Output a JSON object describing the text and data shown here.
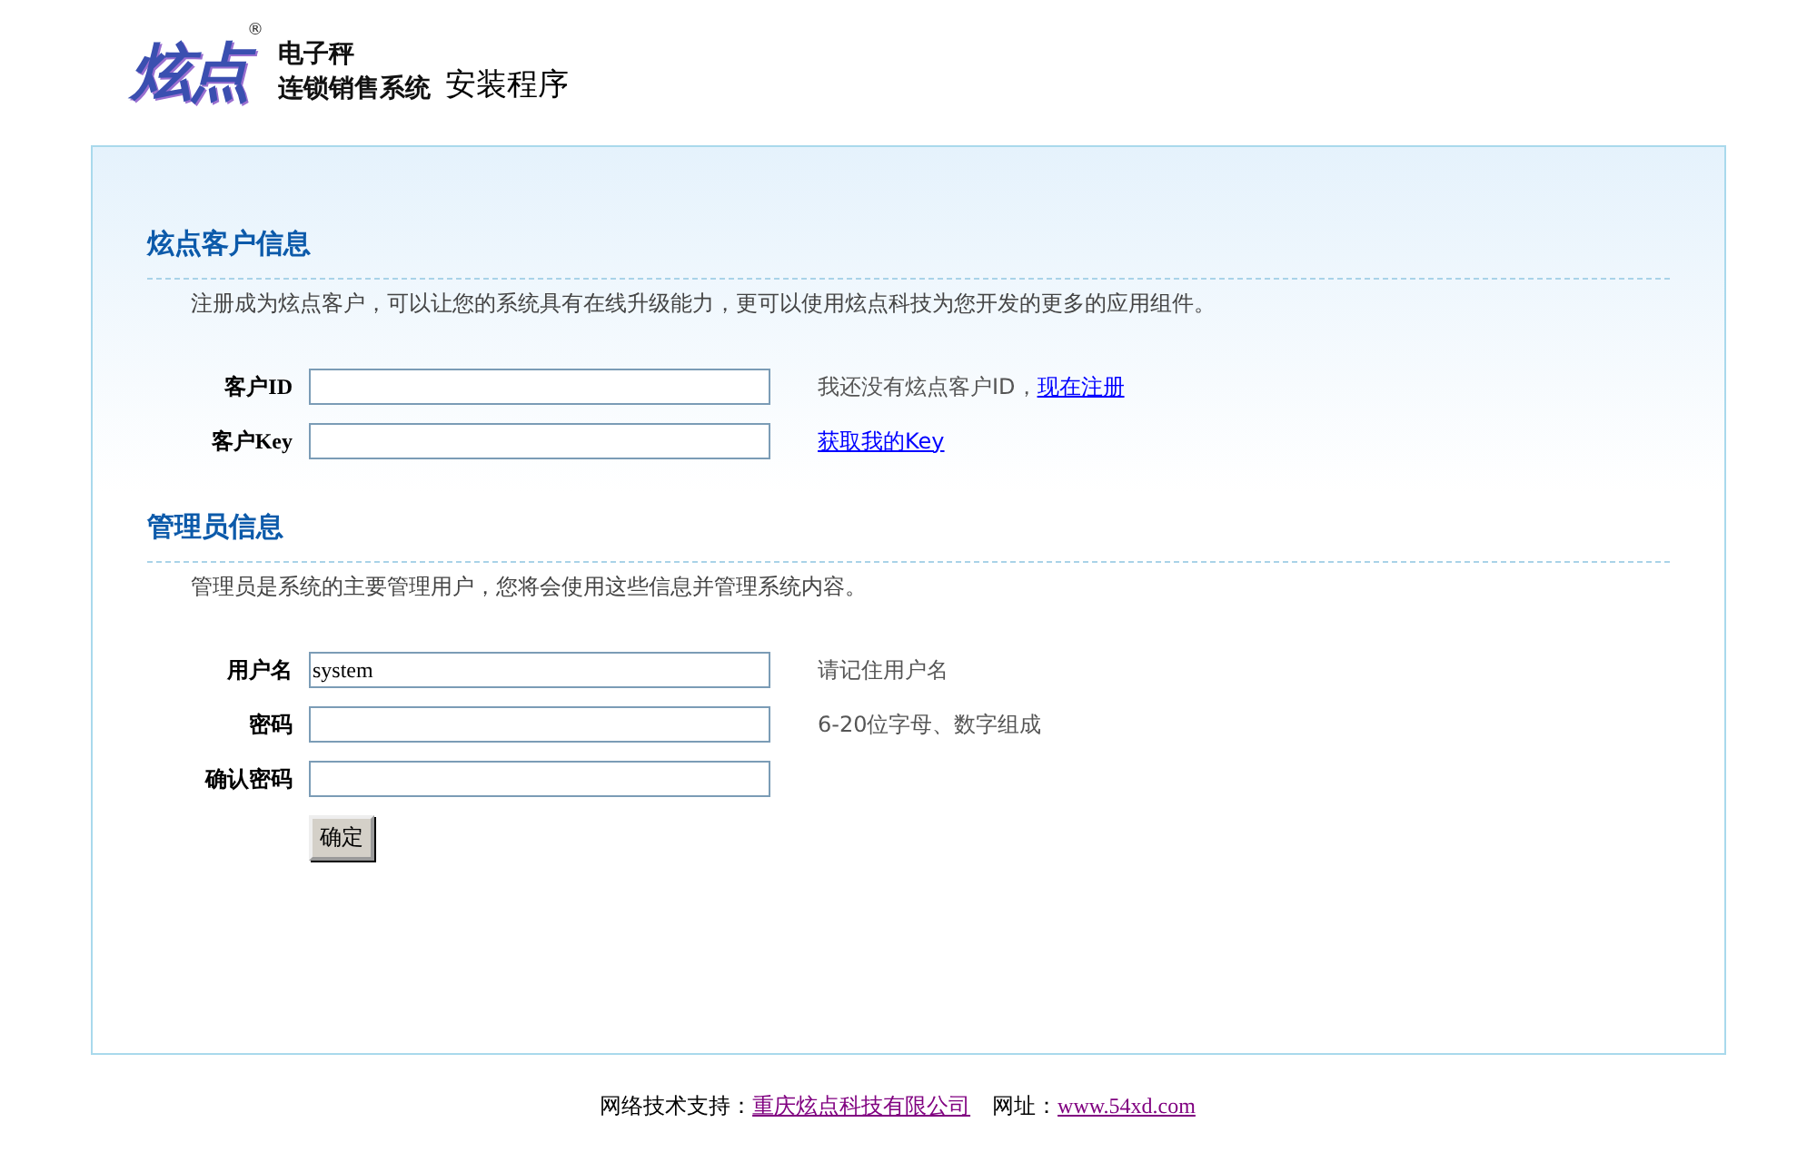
{
  "header": {
    "logo": "炫点",
    "registered_mark": "®",
    "product_lines": [
      "电子秤",
      "连锁销售系统"
    ],
    "title": "安装程序"
  },
  "sections": [
    {
      "title": "炫点客户信息",
      "description": "注册成为炫点客户，可以让您的系统具有在线升级能力，更可以使用炫点科技为您开发的更多的应用组件。",
      "fields": [
        {
          "label": "客户ID",
          "hint": "我还没有炫点客户ID，",
          "link": "现在注册"
        },
        {
          "label": "客户Key",
          "link": "获取我的Key"
        }
      ]
    },
    {
      "title": "管理员信息",
      "description": "管理员是系统的主要管理用户，您将会使用这些信息并管理系统内容。",
      "fields": [
        {
          "label": "用户名",
          "value": "system",
          "hint": "请记住用户名"
        },
        {
          "label": "密码",
          "hint": "6-20位字母、数字组成"
        },
        {
          "label": "确认密码"
        }
      ],
      "button": "确定"
    }
  ],
  "footer": [
    {
      "kind": "text",
      "text": "网络技术支持："
    },
    {
      "kind": "link",
      "text": "重庆炫点科技有限公司"
    },
    {
      "kind": "text",
      "text": "网址："
    },
    {
      "kind": "link",
      "text": "www.54xd.com"
    }
  ]
}
